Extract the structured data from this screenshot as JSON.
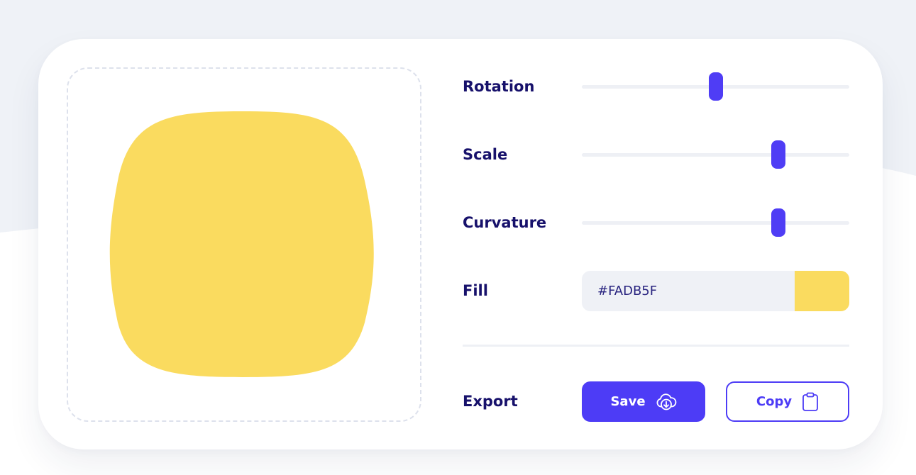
{
  "colors": {
    "accent": "#4D3CF6",
    "label": "#17116B",
    "page_background": "#EFF2F7",
    "canvas_border": "#DDE1EC"
  },
  "preview": {
    "shape_fill": "#FADB5F"
  },
  "controls": {
    "rotation": {
      "label": "Rotation",
      "value_fraction": 0.5
    },
    "scale": {
      "label": "Scale",
      "value_fraction": 0.735
    },
    "curvature": {
      "label": "Curvature",
      "value_fraction": 0.735
    },
    "fill": {
      "label": "Fill",
      "value": "#FADB5F",
      "swatch_color": "#FADB5F"
    },
    "export": {
      "label": "Export",
      "save_label": "Save",
      "save_icon": "cloud-download-icon",
      "copy_label": "Copy",
      "copy_icon": "clipboard-icon"
    }
  }
}
